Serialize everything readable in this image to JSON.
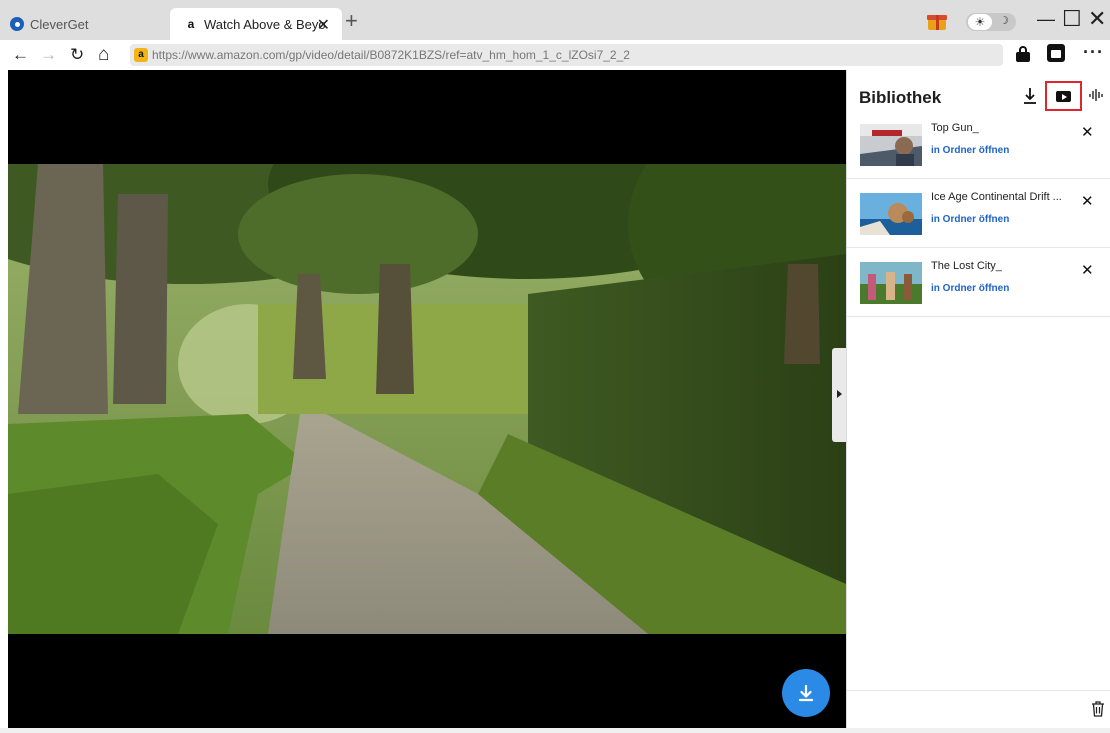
{
  "tabs": [
    {
      "label": "CleverGet"
    },
    {
      "label": "Watch Above & Beyo",
      "favicon": "a"
    }
  ],
  "new_tab_symbol": "+",
  "theme_toggle": {
    "sun": "☀",
    "moon": "☽"
  },
  "window_controls": {
    "minimize": "—",
    "maximize": "☐",
    "close": "✕"
  },
  "nav": {
    "back": "←",
    "forward": "→",
    "reload": "↻",
    "home": "⌂"
  },
  "address": {
    "favicon": "a",
    "url": "https://www.amazon.com/gp/video/detail/B0872K1BZS/ref=atv_hm_hom_1_c_lZOsi7_2_2"
  },
  "toolbar": {
    "more": "···"
  },
  "library": {
    "title": "Bibliothek",
    "items": [
      {
        "title": "Top Gun_",
        "open_label": "in Ordner öffnen"
      },
      {
        "title": "Ice Age Continental Drift ...",
        "open_label": "in Ordner öffnen"
      },
      {
        "title": "The Lost City_",
        "open_label": "in Ordner öffnen"
      }
    ]
  },
  "colors": {
    "accent": "#2b8ae6",
    "highlight": "#e0262a",
    "link": "#1f63c6"
  }
}
